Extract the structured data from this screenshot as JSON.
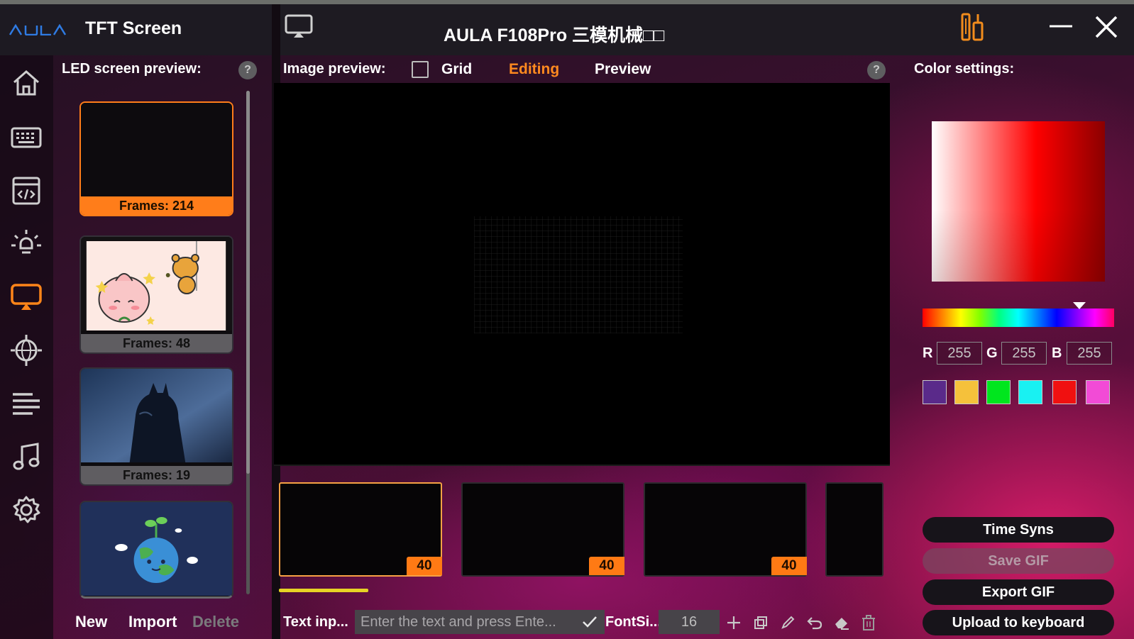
{
  "app": {
    "logo_text": "AULA",
    "title": "TFT Screen",
    "device_title": "AULA F108Pro 三模机械□□"
  },
  "sidebar": {
    "items": [
      {
        "name": "home-icon"
      },
      {
        "name": "keyboard-icon"
      },
      {
        "name": "macro-icon"
      },
      {
        "name": "lighting-icon"
      },
      {
        "name": "screen-icon",
        "active": true
      },
      {
        "name": "network-icon"
      },
      {
        "name": "list-icon"
      },
      {
        "name": "music-icon"
      },
      {
        "name": "settings-icon"
      }
    ]
  },
  "led_preview": {
    "label": "LED screen preview:",
    "help": "?",
    "items": [
      {
        "caption": "Frames: 214",
        "selected": true,
        "image": "black"
      },
      {
        "caption": "Frames: 48",
        "selected": false,
        "image": "peach-cartoon"
      },
      {
        "caption": "Frames: 19",
        "selected": false,
        "image": "batman-rain"
      },
      {
        "caption": "",
        "selected": false,
        "image": "earth-cartoon"
      }
    ],
    "actions": {
      "new": "New",
      "import": "Import",
      "delete": "Delete"
    }
  },
  "image_preview": {
    "label": "Image preview:",
    "grid_label": "Grid",
    "grid_checked": false,
    "tabs": [
      {
        "label": "Editing",
        "active": true
      },
      {
        "label": "Preview",
        "active": false
      }
    ],
    "help": "?"
  },
  "frames": [
    {
      "badge": "40",
      "selected": true
    },
    {
      "badge": "40",
      "selected": false
    },
    {
      "badge": "40",
      "selected": false
    },
    {
      "badge": "",
      "selected": false
    }
  ],
  "toolbar": {
    "text_label": "Text inp...",
    "text_placeholder": "Enter the text and press Ente...",
    "fontsize_label": "FontSi...",
    "fontsize_value": "16"
  },
  "color_settings": {
    "label": "Color settings:",
    "r": "255",
    "g": "255",
    "b": "255",
    "r_label": "R",
    "g_label": "G",
    "b_label": "B",
    "swatches": [
      "#5a2a8a",
      "#f5c13b",
      "#00e61e",
      "#19f1f2",
      "#f01010",
      "#f24bd6"
    ]
  },
  "actions": {
    "time_sync": "Time Syns",
    "save_gif": "Save GIF",
    "export_gif": "Export GIF",
    "upload": "Upload to keyboard"
  },
  "colors": {
    "accent": "#ff7d1a",
    "progress": "#e7d325"
  }
}
